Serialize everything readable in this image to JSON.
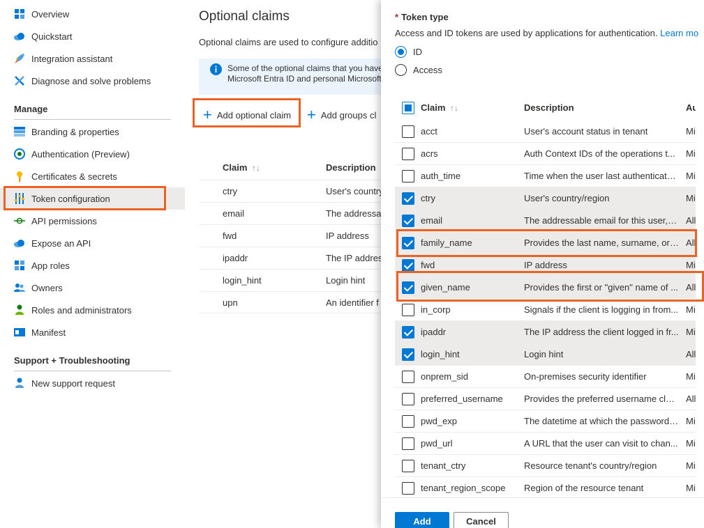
{
  "sidebar": {
    "items": [
      {
        "label": "Overview",
        "icon": "grid-icon"
      },
      {
        "label": "Quickstart",
        "icon": "cloud-icon"
      },
      {
        "label": "Integration assistant",
        "icon": "rocket-icon"
      },
      {
        "label": "Diagnose and solve problems",
        "icon": "tools-icon"
      }
    ],
    "manage_heading": "Manage",
    "manage_items": [
      {
        "label": "Branding & properties",
        "icon": "branding-icon"
      },
      {
        "label": "Authentication (Preview)",
        "icon": "authentication-icon"
      },
      {
        "label": "Certificates & secrets",
        "icon": "key-icon"
      },
      {
        "label": "Token configuration",
        "icon": "sliders-icon",
        "selected": true
      },
      {
        "label": "API permissions",
        "icon": "api-permissions-icon"
      },
      {
        "label": "Expose an API",
        "icon": "cloud-api-icon"
      },
      {
        "label": "App roles",
        "icon": "app-roles-icon"
      },
      {
        "label": "Owners",
        "icon": "owners-icon"
      },
      {
        "label": "Roles and administrators",
        "icon": "roles-icon"
      },
      {
        "label": "Manifest",
        "icon": "manifest-icon"
      }
    ],
    "support_heading": "Support + Troubleshooting",
    "support_items": [
      {
        "label": "New support request",
        "icon": "person-support-icon"
      }
    ]
  },
  "main": {
    "title": "Optional claims",
    "description": "Optional claims are used to configure additio",
    "info_line1": "Some of the optional claims that you have",
    "info_line2": "Microsoft Entra ID and personal Microsoft",
    "add_optional_claim": "Add optional claim",
    "add_groups_claim": "Add groups cl",
    "table_headers": {
      "claim": "Claim",
      "sort": "↑↓",
      "description": "Description"
    },
    "table_rows": [
      {
        "claim": "ctry",
        "description": "User's country"
      },
      {
        "claim": "email",
        "description": "The addressab"
      },
      {
        "claim": "fwd",
        "description": "IP address"
      },
      {
        "claim": "ipaddr",
        "description": "The IP address"
      },
      {
        "claim": "login_hint",
        "description": "Login hint"
      },
      {
        "claim": "upn",
        "description": "An identifier f"
      }
    ]
  },
  "panel": {
    "token_type_label": "Token type",
    "required_mark": "*",
    "token_type_desc": "Access and ID tokens are used by applications for authentication.",
    "learn_more": "Learn mo",
    "radio_id": "ID",
    "radio_access": "Access",
    "selected_token_type": "ID",
    "grid_headers": {
      "claim": "Claim",
      "sort": "↑↓",
      "description": "Description",
      "audience": "Au"
    },
    "claims": [
      {
        "claim": "acct",
        "description": "User's account status in tenant",
        "aud": "Mi",
        "checked": false
      },
      {
        "claim": "acrs",
        "description": "Auth Context IDs of the operations t...",
        "aud": "Mi",
        "checked": false
      },
      {
        "claim": "auth_time",
        "description": "Time when the user last authenticate...",
        "aud": "Mi",
        "checked": false
      },
      {
        "claim": "ctry",
        "description": "User's country/region",
        "aud": "Mi",
        "checked": true
      },
      {
        "claim": "email",
        "description": "The addressable email for this user, if...",
        "aud": "All",
        "checked": true
      },
      {
        "claim": "family_name",
        "description": "Provides the last name, surname, or f...",
        "aud": "All",
        "checked": true
      },
      {
        "claim": "fwd",
        "description": "IP address",
        "aud": "Mi",
        "checked": true
      },
      {
        "claim": "given_name",
        "description": "Provides the first or \"given\" name of ...",
        "aud": "All",
        "checked": true
      },
      {
        "claim": "in_corp",
        "description": "Signals if the client is logging in from...",
        "aud": "Mi",
        "checked": false
      },
      {
        "claim": "ipaddr",
        "description": "The IP address the client logged in fr...",
        "aud": "Mi",
        "checked": true
      },
      {
        "claim": "login_hint",
        "description": "Login hint",
        "aud": "All",
        "checked": true
      },
      {
        "claim": "onprem_sid",
        "description": "On-premises security identifier",
        "aud": "Mi",
        "checked": false
      },
      {
        "claim": "preferred_username",
        "description": "Provides the preferred username clai...",
        "aud": "All",
        "checked": false
      },
      {
        "claim": "pwd_exp",
        "description": "The datetime at which the password ...",
        "aud": "Mi",
        "checked": false
      },
      {
        "claim": "pwd_url",
        "description": "A URL that the user can visit to chan...",
        "aud": "Mi",
        "checked": false
      },
      {
        "claim": "tenant_ctry",
        "description": "Resource tenant's country/region",
        "aud": "Mi",
        "checked": false
      },
      {
        "claim": "tenant_region_scope",
        "description": "Region of the resource tenant",
        "aud": "Mi",
        "checked": false
      }
    ],
    "add_button": "Add",
    "cancel_button": "Cancel"
  },
  "colors": {
    "accent": "#0078d4",
    "highlight": "#ea6325",
    "selected_row": "#edebe9",
    "info_bg": "#ebf3fc"
  }
}
